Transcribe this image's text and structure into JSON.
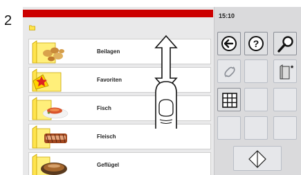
{
  "step_number": "2",
  "clock": "15:10",
  "categories": [
    {
      "label": "Beilagen",
      "icon": "potatoes-icon"
    },
    {
      "label": "Favoriten",
      "icon": "star-folder-icon"
    },
    {
      "label": "Fisch",
      "icon": "fish-icon"
    },
    {
      "label": "Fleisch",
      "icon": "meat-icon"
    },
    {
      "label": "Geflügel",
      "icon": "poultry-icon"
    }
  ],
  "buttons": {
    "back": "back-arrow-icon",
    "help": "help-icon",
    "search": "search-icon",
    "link": "link-icon",
    "add_folder": "add-folder-icon",
    "grid": "grid-icon",
    "start": "start-diamond-icon"
  },
  "colors": {
    "accent_red": "#cc0000",
    "button_border": "#b9bec6",
    "panel": "#dadadc"
  }
}
